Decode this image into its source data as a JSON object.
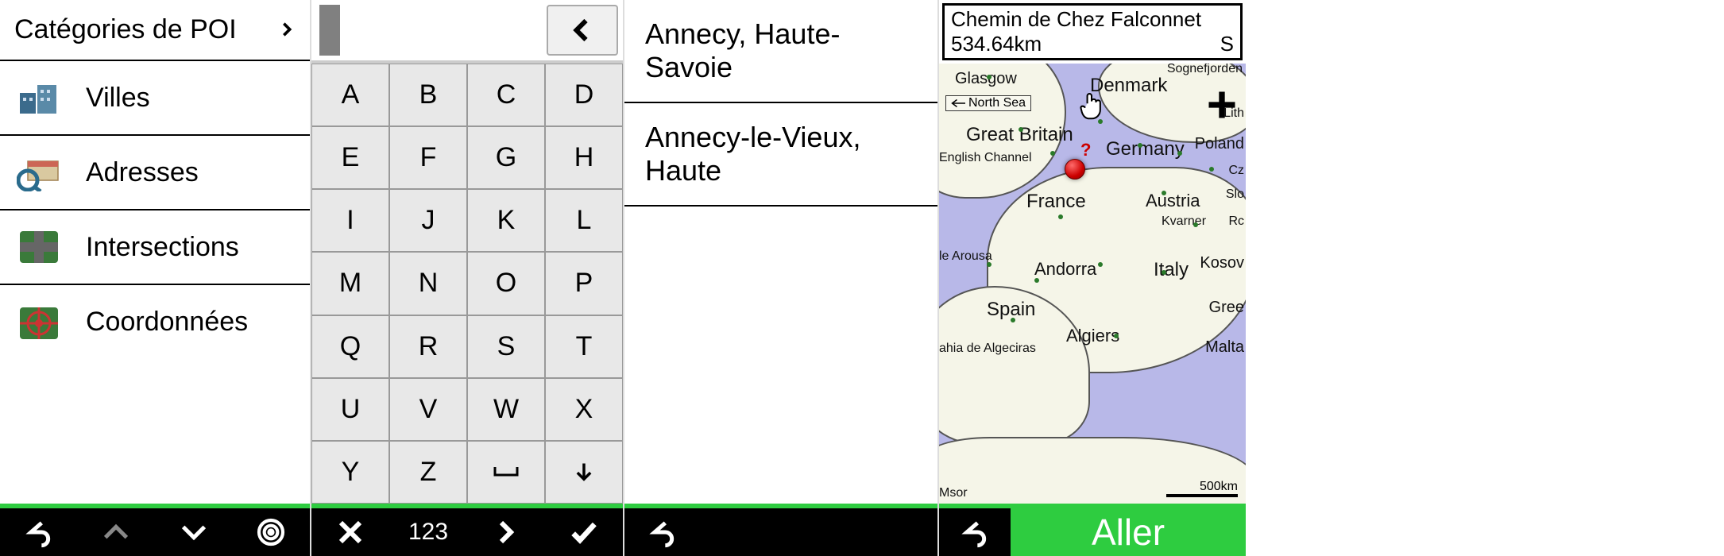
{
  "panel1": {
    "header": "Catégories de POI",
    "items": [
      {
        "label": "Villes",
        "icon": "city-icon"
      },
      {
        "label": "Adresses",
        "icon": "envelope-search-icon"
      },
      {
        "label": "Intersections",
        "icon": "intersection-icon"
      },
      {
        "label": "Coordonnées",
        "icon": "coordinates-icon"
      }
    ]
  },
  "panel2": {
    "input_value": "",
    "keys_rows": [
      [
        "A",
        "B",
        "C",
        "D"
      ],
      [
        "E",
        "F",
        "G",
        "H"
      ],
      [
        "I",
        "J",
        "K",
        "L"
      ],
      [
        "M",
        "N",
        "O",
        "P"
      ],
      [
        "Q",
        "R",
        "S",
        "T"
      ],
      [
        "U",
        "V",
        "W",
        "X"
      ],
      [
        "Y",
        "Z",
        "␣",
        "↓"
      ]
    ],
    "mode_label": "123"
  },
  "panel3": {
    "results": [
      "Annecy, Haute-Savoie",
      "Annecy-le-Vieux, Haute"
    ]
  },
  "panel4": {
    "title": "Chemin de Chez Falconnet",
    "distance": "534.64km",
    "direction": "S",
    "go_label": "Aller",
    "scale": "500km",
    "map_labels": {
      "sognefjorden": "Sognefjorden",
      "glasgow": "Glasgow",
      "denmark": "Denmark",
      "north_sea": "North Sea",
      "great_britain": "Great Britain",
      "germany": "Germany",
      "english_channel": "English Channel",
      "france": "France",
      "austria": "Austria",
      "kvarner": "Kvarner",
      "arousa": "le Arousa",
      "andorra": "Andorra",
      "italy": "Italy",
      "spain": "Spain",
      "bahia_algeciras": "ahia de Algeciras",
      "algiers": "Algiers",
      "lith": "Lith",
      "poland": "Poland",
      "cz": "Cz",
      "slo": "Slo",
      "ro": "Rc",
      "kosov": "Kosov",
      "greece": "Gree",
      "malta": "Malta",
      "msor": "Msor"
    }
  }
}
